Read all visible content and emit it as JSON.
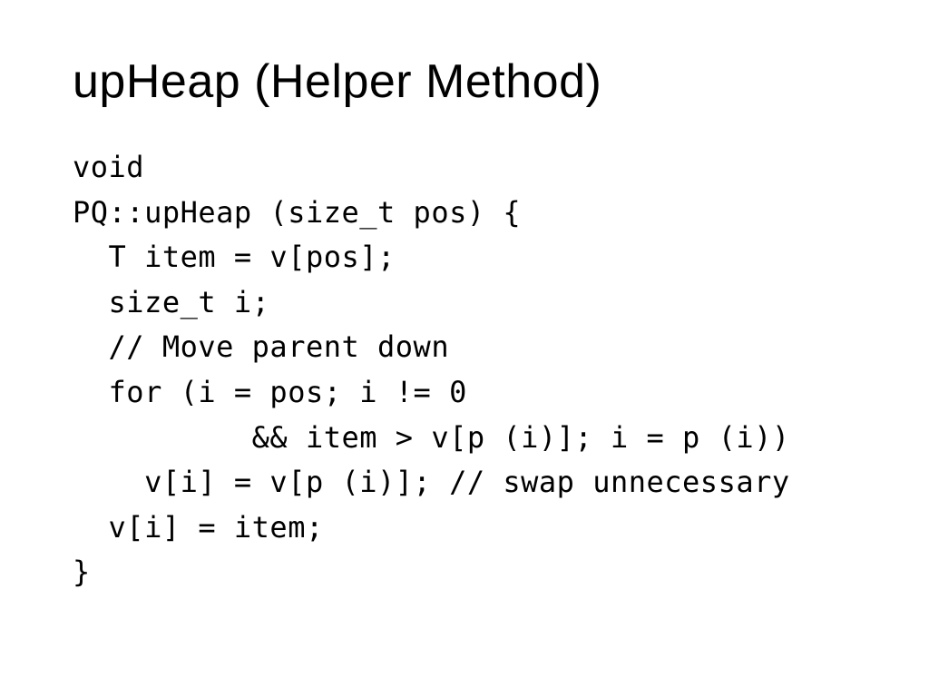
{
  "title": "upHeap (Helper Method)",
  "code_lines": [
    "void",
    "PQ::upHeap (size_t pos) {",
    "  T item = v[pos];",
    "  size_t i;",
    "  // Move parent down",
    "  for (i = pos; i != 0",
    "          && item > v[p (i)]; i = p (i))",
    "    v[i] = v[p (i)]; // swap unnecessary",
    "  v[i] = item;",
    "}"
  ]
}
